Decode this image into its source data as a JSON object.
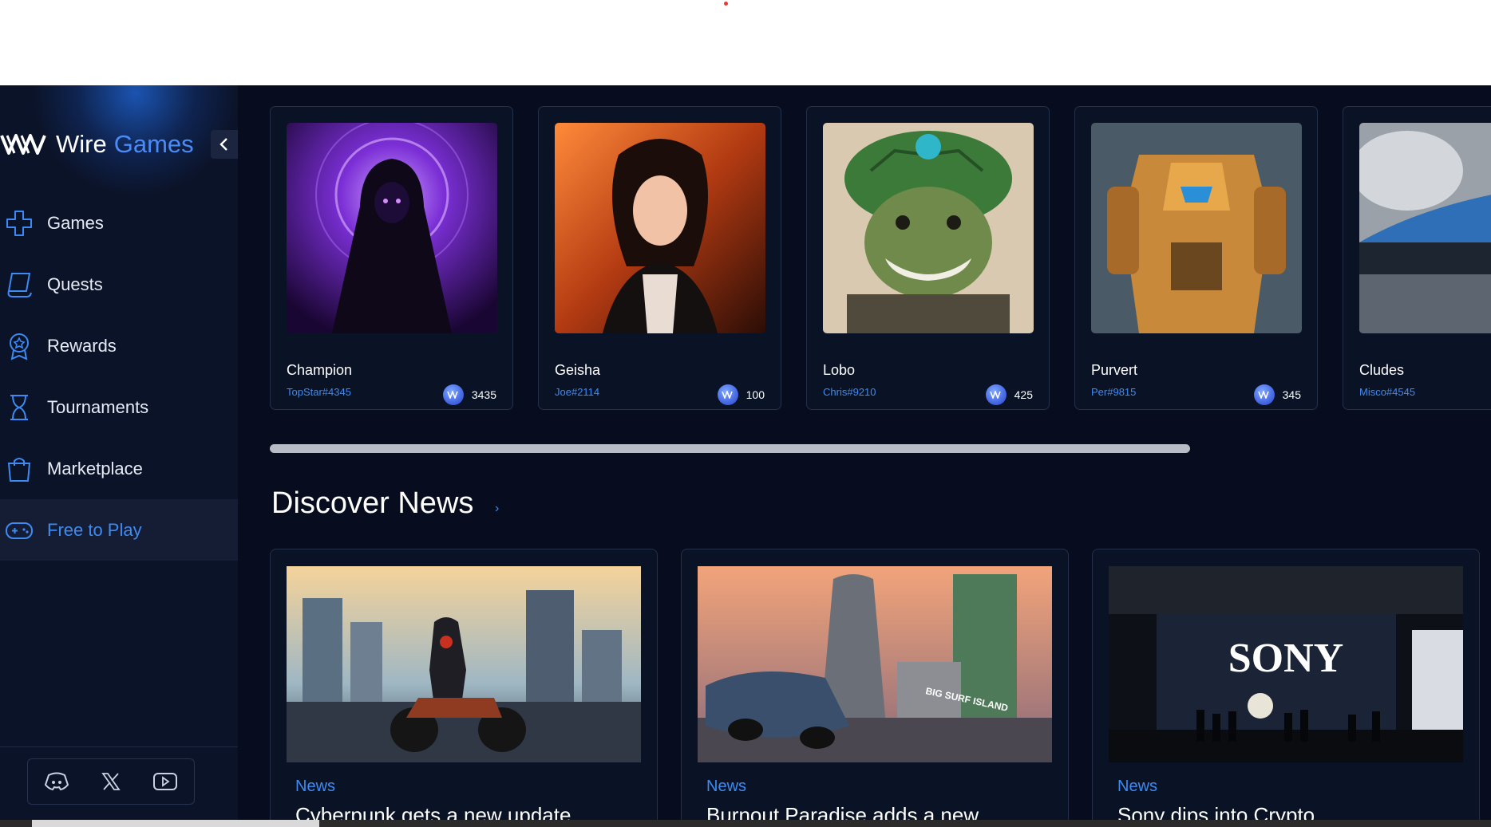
{
  "brand": {
    "word1": "Wire",
    "word2": "Games"
  },
  "sidebar": {
    "items": [
      {
        "label": "Games",
        "icon": "gamepad-cross-icon"
      },
      {
        "label": "Quests",
        "icon": "quest-scroll-icon"
      },
      {
        "label": "Rewards",
        "icon": "award-badge-icon"
      },
      {
        "label": "Tournaments",
        "icon": "hourglass-icon"
      },
      {
        "label": "Marketplace",
        "icon": "shopping-bag-icon"
      },
      {
        "label": "Free to Play",
        "icon": "gamepad-icon",
        "active": true
      }
    ],
    "social": [
      "discord-icon",
      "x-icon",
      "youtube-icon"
    ]
  },
  "players": [
    {
      "name": "Champion",
      "tag": "TopStar#4345",
      "score": "3435"
    },
    {
      "name": "Geisha",
      "tag": "Joe#2114",
      "score": "100"
    },
    {
      "name": "Lobo",
      "tag": "Chris#9210",
      "score": "425"
    },
    {
      "name": "Purvert",
      "tag": "Per#9815",
      "score": "345"
    },
    {
      "name": "Cludes",
      "tag": "Misco#4545",
      "score": ""
    }
  ],
  "news_section": {
    "title": "Discover News",
    "arrow": "›"
  },
  "news": [
    {
      "category": "News",
      "title": "Cyberpunk gets a new update"
    },
    {
      "category": "News",
      "title": "Burnout Paradise adds a new"
    },
    {
      "category": "News",
      "title": "Sony dips into Crypto"
    }
  ],
  "news_images": {
    "sony_sign": "SONY",
    "street_sign": "BIG SURF ISLAND"
  },
  "colors": {
    "accent": "#3d8bf2",
    "background": "#070d1f",
    "sidebar": "#0b1328"
  }
}
